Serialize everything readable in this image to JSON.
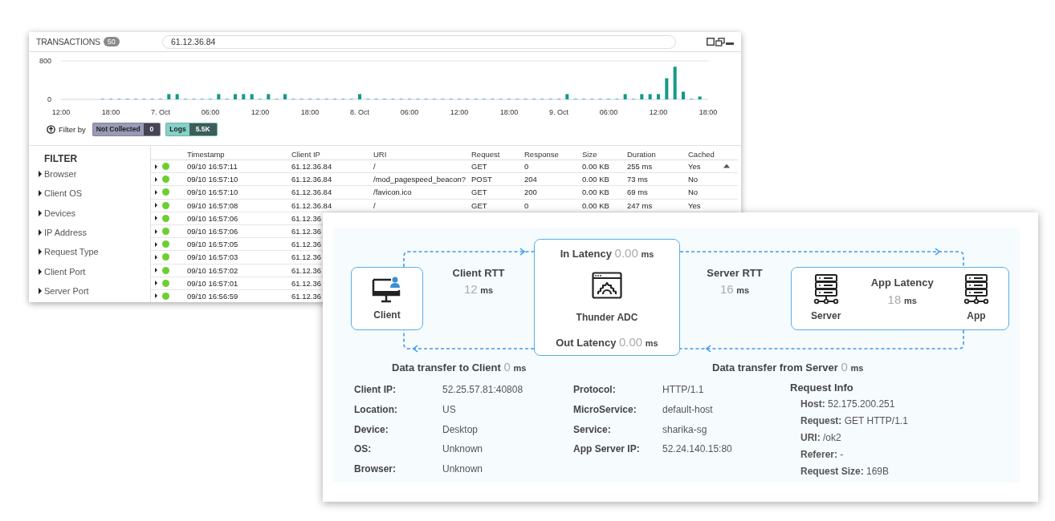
{
  "transactions_window": {
    "title": "TRANSACTIONS",
    "count": "50",
    "search": {
      "value": "61.12.36.84"
    },
    "chart_data": {
      "type": "bar",
      "categories": [
        "12:00",
        null,
        null,
        null,
        null,
        null,
        "18:00",
        null,
        null,
        null,
        null,
        null,
        "7. Oct",
        null,
        null,
        null,
        null,
        null,
        "06:00",
        null,
        null,
        null,
        null,
        null,
        "12:00",
        null,
        null,
        null,
        null,
        null,
        "18:00",
        null,
        null,
        null,
        null,
        null,
        "8. Oct",
        null,
        null,
        null,
        null,
        null,
        "06:00",
        null,
        null,
        null,
        null,
        null,
        "12:00",
        null,
        null,
        null,
        null,
        null,
        "18:00",
        null,
        null,
        null,
        null,
        null,
        "9. Oct",
        null,
        null,
        null,
        null,
        null,
        "06:00",
        null,
        null,
        null,
        null,
        null,
        "12:00",
        null,
        null,
        null,
        null,
        null,
        "18:00"
      ],
      "values": [
        null,
        null,
        null,
        null,
        null,
        10,
        10,
        10,
        10,
        10,
        10,
        10,
        10,
        110,
        110,
        10,
        10,
        10,
        10,
        110,
        10,
        110,
        110,
        110,
        10,
        110,
        10,
        110,
        10,
        10,
        10,
        10,
        10,
        10,
        10,
        10,
        110,
        10,
        10,
        10,
        10,
        10,
        10,
        10,
        10,
        10,
        10,
        10,
        10,
        10,
        10,
        10,
        10,
        10,
        10,
        10,
        10,
        10,
        10,
        10,
        10,
        110,
        10,
        10,
        10,
        10,
        10,
        10,
        110,
        10,
        110,
        110,
        110,
        440,
        680,
        160,
        10,
        60,
        null
      ],
      "ylim": [
        0,
        800
      ],
      "yticks": [
        0,
        800
      ]
    },
    "filter_by": {
      "label": "Filter by",
      "chips": [
        {
          "label": "Not Collected",
          "count": "0",
          "color": "#9a9ab8"
        },
        {
          "label": "Logs",
          "count": "5.5K",
          "color": "#84d1c8"
        }
      ]
    },
    "filter": {
      "title": "FILTER",
      "items": [
        {
          "label": "Browser",
          "expanded": false
        },
        {
          "label": "Client OS",
          "expanded": false
        },
        {
          "label": "Devices",
          "expanded": false
        },
        {
          "label": "IP Address",
          "expanded": false
        },
        {
          "label": "Request Type",
          "expanded": false
        },
        {
          "label": "Client Port",
          "expanded": false
        },
        {
          "label": "Server Port",
          "expanded": false
        }
      ]
    },
    "table": {
      "columns": [
        "Timestamp",
        "Client IP",
        "URI",
        "Request",
        "Response",
        "Size",
        "Duration",
        "Cached"
      ],
      "rows": [
        {
          "expanded": false,
          "cells": [
            "09/10 16:57:11",
            "61.12.36.84",
            "/",
            "GET",
            "0",
            "0.00 KB",
            "255 ms",
            "Yes"
          ]
        },
        {
          "expanded": false,
          "cells": [
            "09/10 16:57:10",
            "61.12.36.84",
            "/mod_pagespeed_beacon?",
            "POST",
            "204",
            "0.00 KB",
            "73 ms",
            "No"
          ]
        },
        {
          "expanded": false,
          "cells": [
            "09/10 16:57:10",
            "61.12.36.84",
            "/favicon.ico",
            "GET",
            "200",
            "0.00 KB",
            "69 ms",
            "No"
          ]
        },
        {
          "expanded": false,
          "cells": [
            "09/10 16:57:08",
            "61.12.36.84",
            "/",
            "GET",
            "0",
            "0.00 KB",
            "247 ms",
            "Yes"
          ]
        },
        {
          "expanded": false,
          "cells": [
            "09/10 16:57:06",
            "61.12.36"
          ]
        },
        {
          "expanded": false,
          "cells": [
            "09/10 16:57:06",
            "61.12.36"
          ]
        },
        {
          "expanded": false,
          "cells": [
            "09/10 16:57:05",
            "61.12.36"
          ]
        },
        {
          "expanded": false,
          "cells": [
            "09/10 16:57:03",
            "61.12.36"
          ]
        },
        {
          "expanded": false,
          "cells": [
            "09/10 16:57:02",
            "61.12.36"
          ]
        },
        {
          "expanded": false,
          "cells": [
            "09/10 16:57:01",
            "61.12.36"
          ]
        },
        {
          "expanded": false,
          "cells": [
            "09/10 16:56:59",
            "61.12.36"
          ]
        }
      ]
    }
  },
  "transaction_detail": {
    "client": {
      "label": "Client"
    },
    "client_rtt": {
      "label": "Client RTT",
      "value": "12",
      "unit": "ms"
    },
    "adc": {
      "label": "Thunder ADC",
      "in_latency": {
        "label": "In Latency",
        "value": "0.00",
        "unit": "ms"
      },
      "out_latency": {
        "label": "Out Latency",
        "value": "0.00",
        "unit": "ms"
      }
    },
    "server_rtt": {
      "label": "Server RTT",
      "value": "16",
      "unit": "ms"
    },
    "server": {
      "label": "Server"
    },
    "app_latency": {
      "label": "App Latency",
      "value": "18",
      "unit": "ms"
    },
    "app": {
      "label": "App"
    },
    "data_to_client": {
      "label": "Data transfer to Client",
      "value": "0",
      "unit": "ms"
    },
    "data_from_server": {
      "label": "Data transfer from Server",
      "value": "0",
      "unit": "ms"
    },
    "client_info": [
      {
        "label": "Client IP:",
        "value": "52.25.57.81:40808"
      },
      {
        "label": "Location:",
        "value": "US"
      },
      {
        "label": "Device:",
        "value": "Desktop"
      },
      {
        "label": "OS:",
        "value": "Unknown"
      },
      {
        "label": "Browser:",
        "value": "Unknown"
      }
    ],
    "server_info": [
      {
        "label": "Protocol:",
        "value": "HTTP/1.1"
      },
      {
        "label": "MicroService:",
        "value": "default-host"
      },
      {
        "label": "Service:",
        "value": "sharika-sg"
      },
      {
        "label": "App Server IP:",
        "value": "52.24.140.15:80"
      }
    ],
    "request_info": {
      "title": "Request Info",
      "items": [
        "**Host:** 52.175.200.251",
        "**Request:** GET HTTP/1.1",
        "**URI:** /ok2",
        "**Referer:** -",
        "**Request Size:** 169B"
      ]
    }
  }
}
